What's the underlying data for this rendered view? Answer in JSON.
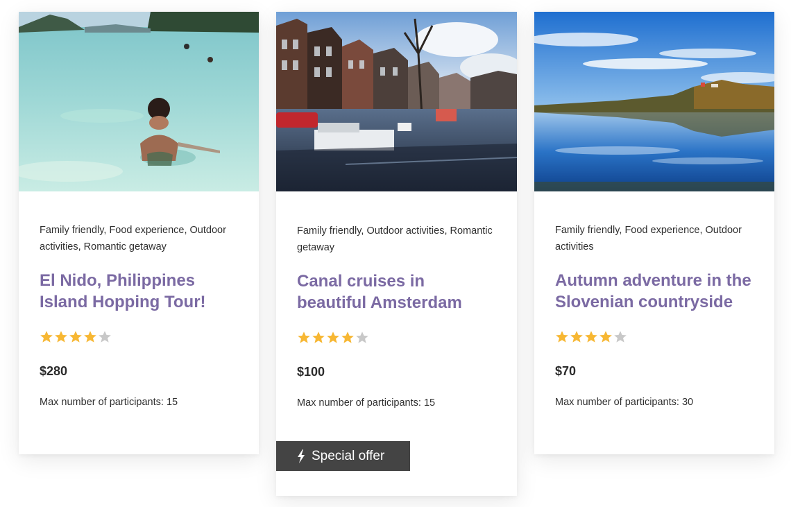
{
  "colors": {
    "title": "#7b6aa3",
    "star_filled": "#f7b733",
    "star_empty": "#c8c8c8",
    "badge_bg": "#444444"
  },
  "cards": [
    {
      "image_icon": "beach-swimming-photo",
      "tags": "Family friendly, Food experience, Outdoor activities, Romantic getaway",
      "title": "El Nido, Philippines Island Hopping Tour!",
      "rating": 4,
      "rating_max": 5,
      "price": "$280",
      "max_participants": "Max number of participants: 15"
    },
    {
      "image_icon": "amsterdam-canal-photo",
      "tags": "Family friendly, Outdoor activities, Romantic getaway",
      "title": "Canal cruises in beautiful Amsterdam",
      "rating": 4,
      "rating_max": 5,
      "price": "$100",
      "max_participants": "Max number of participants: 15",
      "badge": {
        "icon": "bolt-icon",
        "label": "Special offer"
      }
    },
    {
      "image_icon": "lake-reflection-photo",
      "tags": "Family friendly, Food experience, Outdoor activities",
      "title": "Autumn adventure in the Slovenian countryside",
      "rating": 4,
      "rating_max": 5,
      "price": "$70",
      "max_participants": "Max number of participants: 30"
    }
  ]
}
